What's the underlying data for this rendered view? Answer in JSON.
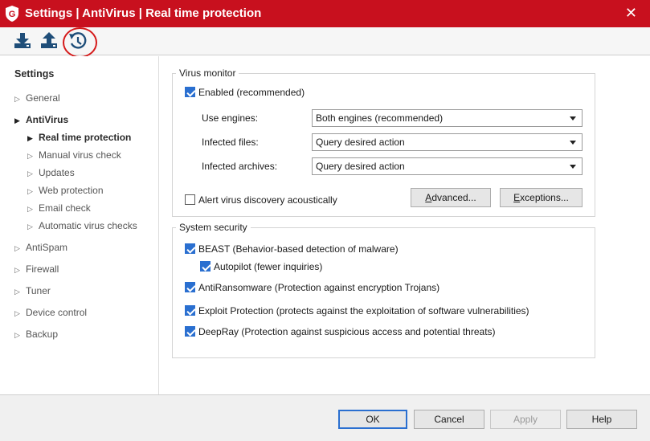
{
  "window": {
    "title": "Settings | AntiVirus | Real time protection",
    "close_symbol": "✕",
    "logo_icon": "g-data-shield-icon"
  },
  "toolbar": {
    "buttons": [
      {
        "icon": "download-icon"
      },
      {
        "icon": "upload-icon"
      },
      {
        "icon": "history-restore-icon"
      }
    ],
    "highlight_color": "#d51a1a"
  },
  "sidebar": {
    "heading": "Settings",
    "items": [
      {
        "label": "General"
      },
      {
        "label": "AntiVirus"
      },
      {
        "label": "Real time protection"
      },
      {
        "label": "Manual virus check"
      },
      {
        "label": "Updates"
      },
      {
        "label": "Web protection"
      },
      {
        "label": "Email check"
      },
      {
        "label": "Automatic virus checks"
      },
      {
        "label": "AntiSpam"
      },
      {
        "label": "Firewall"
      },
      {
        "label": "Tuner"
      },
      {
        "label": "Device control"
      },
      {
        "label": "Backup"
      }
    ]
  },
  "virus_monitor": {
    "legend": "Virus monitor",
    "enabled_label": "Enabled (recommended)",
    "use_engines_label": "Use engines:",
    "use_engines_value": "Both engines (recommended)",
    "infected_files_label": "Infected files:",
    "infected_files_value": "Query desired action",
    "infected_archives_label": "Infected archives:",
    "infected_archives_value": "Query desired action",
    "alert_label": "Alert virus discovery acoustically",
    "advanced_label": "dvanced...",
    "advanced_mnemonic": "A",
    "exceptions_label": "xceptions...",
    "exceptions_mnemonic": "E"
  },
  "system_security": {
    "legend": "System security",
    "beast_label": "BEAST (Behavior-based detection of malware)",
    "autopilot_label": "Autopilot (fewer inquiries)",
    "antiransomware_label": "AntiRansomware (Protection against encryption Trojans)",
    "exploit_label": "Exploit Protection (protects against the exploitation of software vulnerabilities)",
    "deepray_label": "DeepRay (Protection against suspicious access and potential threats)"
  },
  "footer": {
    "ok_label": "OK",
    "cancel_label": "Cancel",
    "apply_label": "Apply",
    "help_label": "Help"
  },
  "colors": {
    "title_bar": "#c8101e",
    "checkbox_checked": "#2a6fd0"
  }
}
